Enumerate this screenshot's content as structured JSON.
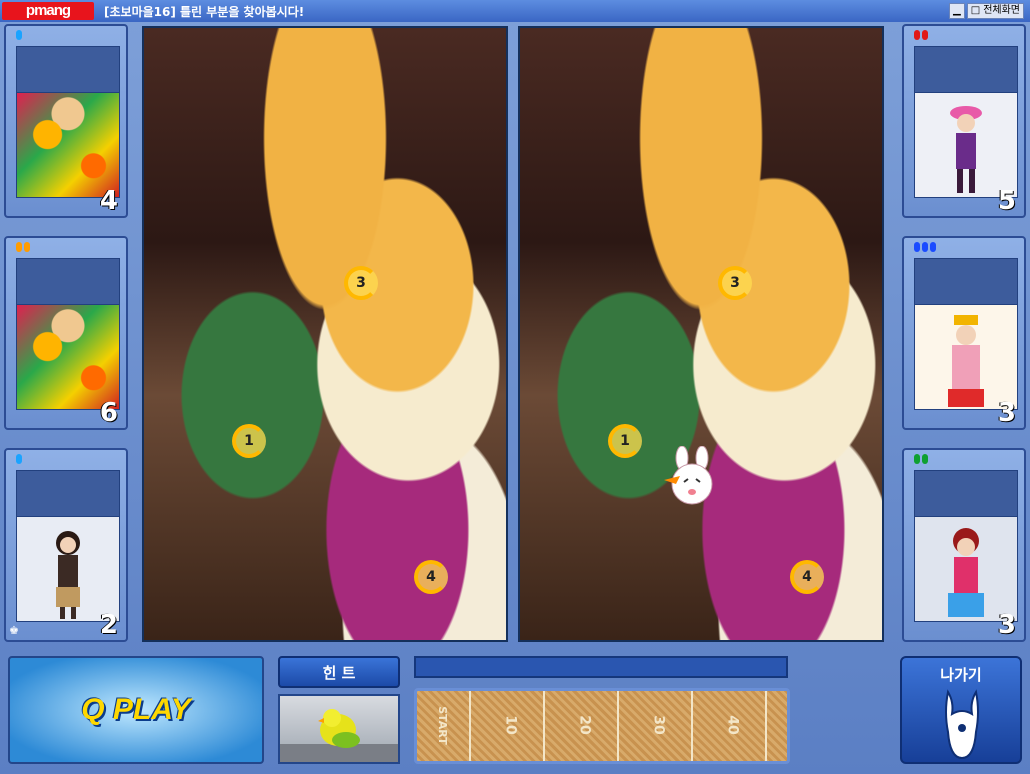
{
  "window": {
    "logo": "pmang",
    "title": "[초보마을16] 틀린 부분을 찾아봅시다!",
    "fullscreen_label": "전체화면"
  },
  "players_left": [
    {
      "score": "4",
      "gems": [
        "#1aa3ff"
      ]
    },
    {
      "score": "6",
      "gems": [
        "#ff9c00",
        "#ff9c00"
      ]
    },
    {
      "score": "2",
      "gems": [
        "#1aa3ff"
      ],
      "badge": "♚"
    }
  ],
  "players_right": [
    {
      "score": "5",
      "gems": [
        "#e01818",
        "#e01818"
      ]
    },
    {
      "score": "3",
      "gems": [
        "#1a4bff",
        "#1a4bff",
        "#1a4bff"
      ]
    },
    {
      "score": "3",
      "gems": [
        "#0fa030",
        "#0fa030"
      ]
    }
  ],
  "markers": [
    "1",
    "3",
    "4"
  ],
  "bottom": {
    "qplay": "Q PLAY",
    "hint_label": "힌 트",
    "exit_label": "나가기",
    "field_marks": [
      "START",
      "10",
      "20",
      "30",
      "40"
    ]
  }
}
